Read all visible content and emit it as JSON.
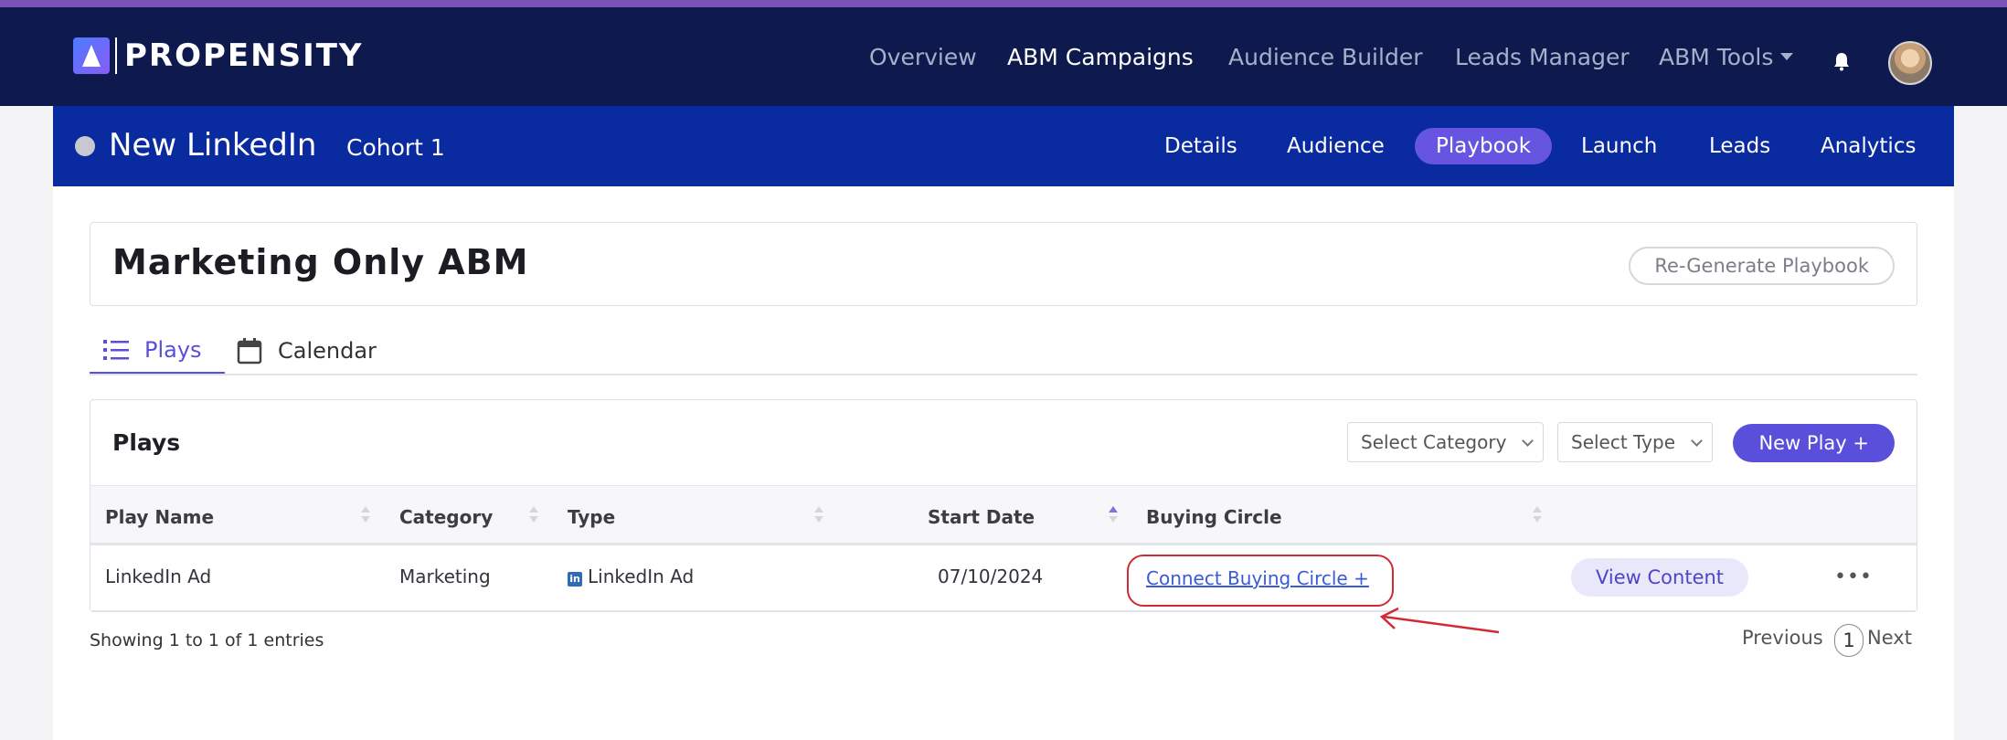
{
  "brand": {
    "name": "PROPENSITY"
  },
  "topnav": {
    "items": [
      "Overview",
      "ABM Campaigns",
      "Audience Builder",
      "Leads Manager",
      "ABM Tools"
    ],
    "active": "ABM Campaigns"
  },
  "campaign": {
    "name": "New LinkedIn",
    "cohort": "Cohort 1",
    "tabs": [
      "Details",
      "Audience",
      "Playbook",
      "Launch",
      "Leads",
      "Analytics"
    ],
    "active_tab": "Playbook"
  },
  "playbook": {
    "title": "Marketing Only ABM",
    "regenerate_label": "Re-Generate Playbook",
    "view_tabs": [
      "Plays",
      "Calendar"
    ],
    "active_view": "Plays"
  },
  "plays": {
    "title": "Plays",
    "category_select": "Select Category",
    "type_select": "Select Type",
    "new_play_label": "New Play +",
    "columns": [
      "Play Name",
      "Category",
      "Type",
      "Start Date",
      "Buying Circle"
    ],
    "rows": [
      {
        "name": "LinkedIn Ad",
        "category": "Marketing",
        "type": "LinkedIn Ad",
        "start_date": "07/10/2024",
        "buying_circle_link": "Connect Buying Circle +",
        "view_content_label": "View Content",
        "more": "•••"
      }
    ],
    "showing": "Showing 1 to 1 of 1 entries",
    "pager": {
      "previous": "Previous",
      "page": "1",
      "next": "Next"
    }
  },
  "colors": {
    "topnav_bg": "#0e1a4e",
    "subbar_bg": "#0a2aa0",
    "accent": "#5a4fdb",
    "annotation_red": "#d22a35"
  }
}
